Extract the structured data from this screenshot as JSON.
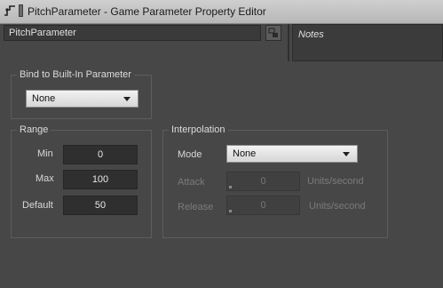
{
  "window": {
    "title": "PitchParameter - Game Parameter Property Editor"
  },
  "name_field": {
    "value": "PitchParameter"
  },
  "notes": {
    "label": "Notes"
  },
  "bind_builtin": {
    "title": "Bind to Built-In Parameter",
    "selected": "None"
  },
  "range": {
    "title": "Range",
    "min_label": "Min",
    "min_value": "0",
    "max_label": "Max",
    "max_value": "100",
    "default_label": "Default",
    "default_value": "50"
  },
  "interpolation": {
    "title": "Interpolation",
    "mode_label": "Mode",
    "mode_selected": "None",
    "attack_label": "Attack",
    "attack_value": "0",
    "attack_units": "Units/second",
    "release_label": "Release",
    "release_value": "0",
    "release_units": "Units/second"
  },
  "icons": {
    "app": "parameter-icon",
    "side_button": "layout-icon",
    "dropdown_arrow": "chevron-down-icon"
  }
}
